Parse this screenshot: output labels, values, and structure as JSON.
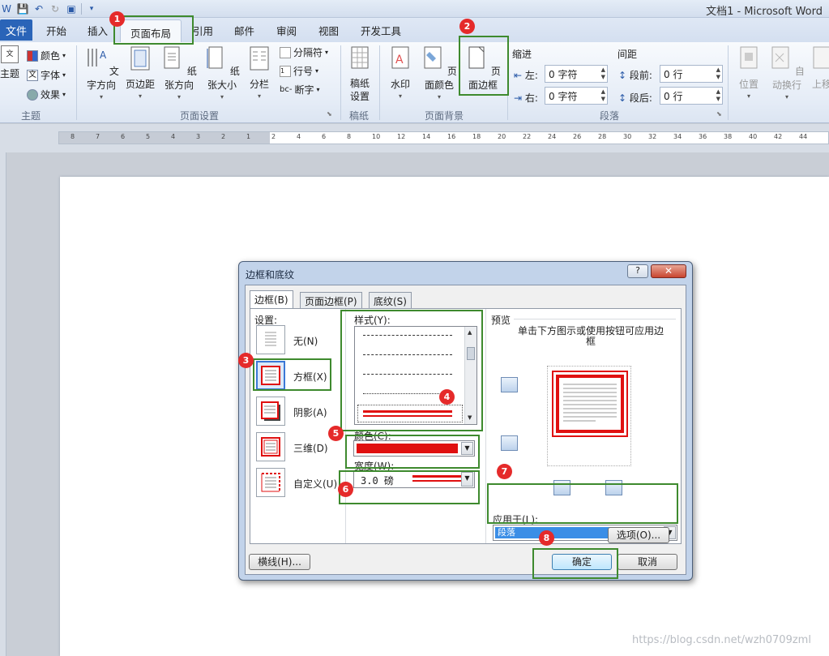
{
  "window": {
    "title": "文档1 - Microsoft Word"
  },
  "tabs": [
    "文件",
    "开始",
    "插入",
    "页面布局",
    "引用",
    "邮件",
    "审阅",
    "视图",
    "开发工具"
  ],
  "ribbon": {
    "theme": {
      "big": "主题",
      "colors": "颜色",
      "fonts": "字体",
      "effects": "效果",
      "group": "主题"
    },
    "page_setup": {
      "text_direction": "文字方向",
      "margins": "页边距",
      "orientation": "纸张方向",
      "size": "纸张大小",
      "columns": "分栏",
      "breaks": "分隔符",
      "line_numbers": "行号",
      "hyphenation": "断字",
      "group": "页面设置"
    },
    "manuscript": {
      "setup": "稿纸\n设置",
      "group": "稿纸"
    },
    "page_background": {
      "watermark": "水印",
      "page_color": "页面颜色",
      "page_borders": "页面边框",
      "group": "页面背景"
    },
    "paragraph": {
      "indent_title": "缩进",
      "spacing_title": "间距",
      "left_label": "左:",
      "left_value": "0 字符",
      "right_label": "右:",
      "right_value": "0 字符",
      "before_label": "段前:",
      "before_value": "0 行",
      "after_label": "段后:",
      "after_value": "0 行",
      "group": "段落"
    },
    "arrange": {
      "position": "位置",
      "wrap_text": "自动换行",
      "bring_forward": "上移"
    }
  },
  "ruler": {
    "numbers": [
      "8",
      "7",
      "6",
      "5",
      "4",
      "3",
      "2",
      "1",
      "2",
      "4",
      "6",
      "8",
      "10",
      "12",
      "14",
      "16",
      "18",
      "20",
      "22",
      "24",
      "26",
      "28",
      "30",
      "32",
      "34",
      "36",
      "38",
      "40",
      "42",
      "44"
    ]
  },
  "dialog": {
    "title": "边框和底纹",
    "help": "?",
    "tabs": [
      "边框(B)",
      "页面边框(P)",
      "底纹(S)"
    ],
    "settings_title": "设置:",
    "settings": [
      "无(N)",
      "方框(X)",
      "阴影(A)",
      "三维(D)",
      "自定义(U)"
    ],
    "style_title": "样式(Y):",
    "color_title": "颜色(C):",
    "width_title": "宽度(W):",
    "width_value": "3.0 磅",
    "preview_title": "预览",
    "preview_hint": "单击下方图示或使用按钮可应用边框",
    "apply_to_title": "应用于(L):",
    "apply_to_value": "段落",
    "options": "选项(O)...",
    "horizontal_line": "横线(H)...",
    "ok": "确定",
    "cancel": "取消"
  },
  "annotations": [
    "1",
    "2",
    "3",
    "4",
    "5",
    "6",
    "7",
    "8"
  ],
  "watermark_text": "https://blog.csdn.net/wzh0709zml",
  "colors": {
    "border_red": "#e01010",
    "annotation_green": "#3e8a2e",
    "badge_red": "#e52a2a"
  }
}
